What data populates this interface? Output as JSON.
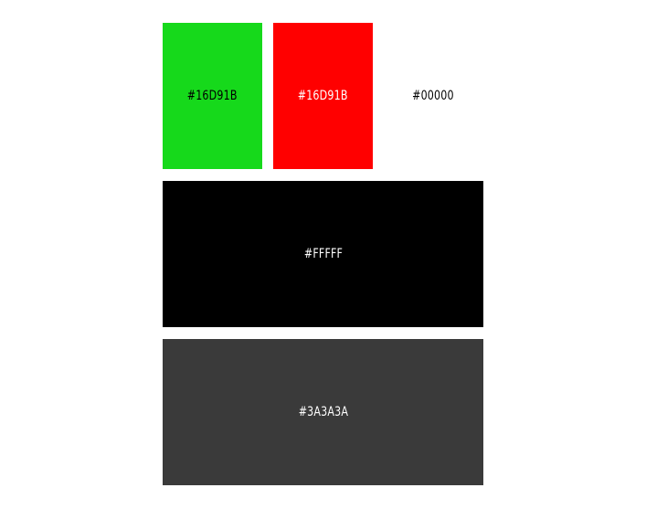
{
  "swatches": [
    {
      "id": "green",
      "label": "#16D91B",
      "fill": "#16D91B",
      "text_color": "#000000"
    },
    {
      "id": "red",
      "label": "#16D91B",
      "fill": "#FF0000",
      "text_color": "#FFFFFF"
    },
    {
      "id": "white",
      "label": "#00000",
      "fill": "#FFFFFF",
      "text_color": "#000000"
    },
    {
      "id": "black",
      "label": "#FFFFF",
      "fill": "#000000",
      "text_color": "#FFFFFF"
    },
    {
      "id": "gray",
      "label": "#3A3A3A",
      "fill": "#3A3A3A",
      "text_color": "#FFFFFF"
    }
  ]
}
